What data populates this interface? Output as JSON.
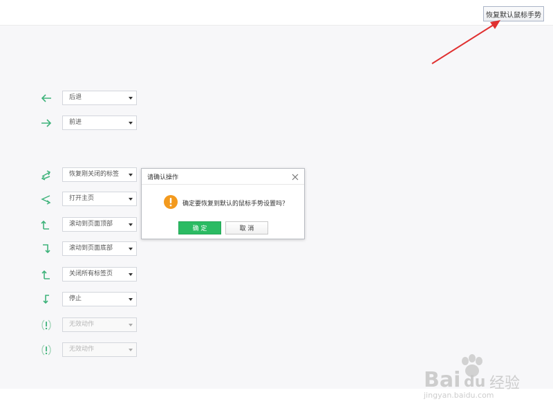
{
  "header": {
    "restore_button_label": "恢复默认鼠标手势"
  },
  "colors": {
    "gesture_green": "#3fb37b",
    "ok_green": "#2bbb63",
    "annotation_red": "#e03030"
  },
  "gestures": [
    {
      "icon": "arrow-left-icon",
      "action": "后退",
      "enabled": true
    },
    {
      "icon": "arrow-right-icon",
      "action": "前进",
      "enabled": true
    },
    {
      "icon": "right-left-gesture-icon",
      "action": "恢复刚关闭的标签",
      "enabled": true
    },
    {
      "icon": "left-right-gesture-icon",
      "action": "打开主页",
      "enabled": true
    },
    {
      "icon": "up-right-gesture-icon",
      "action": "滚动到页面顶部",
      "enabled": true
    },
    {
      "icon": "down-right-gesture-icon",
      "action": "滚动到页面底部",
      "enabled": true
    },
    {
      "icon": "up-left-gesture-icon",
      "action": "关闭所有标签页",
      "enabled": true
    },
    {
      "icon": "down-left-gesture-icon",
      "action": "停止",
      "enabled": true
    },
    {
      "icon": "invalid-gesture-icon",
      "action": "无效动作",
      "enabled": false
    },
    {
      "icon": "invalid-gesture-icon",
      "action": "无效动作",
      "enabled": false
    }
  ],
  "dialog": {
    "title": "请确认操作",
    "message": "确定要恢复到默认的鼠标手势设置吗？",
    "ok_label": "确 定",
    "cancel_label": "取 消",
    "icon": "warning-icon"
  },
  "watermark": {
    "brand": "Bai",
    "brand_tail": "du",
    "product": "经验",
    "url": "jingyan.baidu.com"
  }
}
